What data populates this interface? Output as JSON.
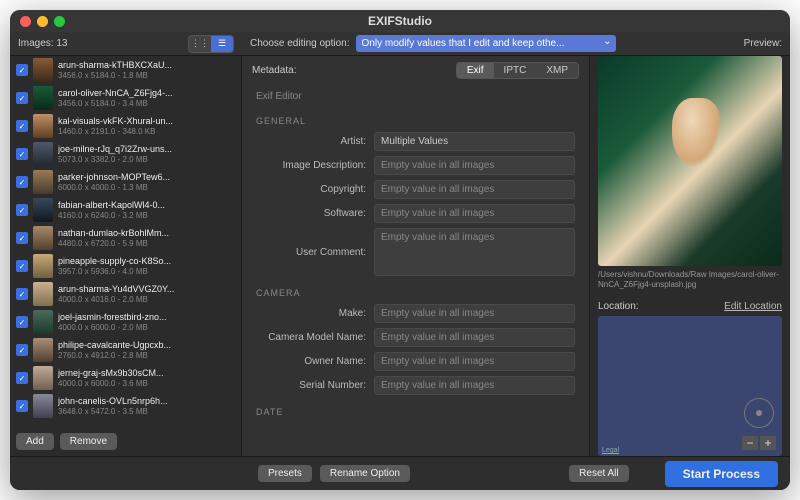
{
  "window": {
    "title": "EXIFStudio"
  },
  "toolbar": {
    "images_label": "Images:",
    "images_count": "13",
    "editing_label": "Choose editing option:",
    "editing_value": "Only modify values that I edit and keep othe...",
    "preview_label": "Preview:"
  },
  "sidebar": {
    "items": [
      {
        "name": "arun-sharma-kTHBXCXaU...",
        "info": "3456.0 x 5184.0 - 1.8 MB"
      },
      {
        "name": "carol-oliver-NnCA_Z6Fjg4-...",
        "info": "3456.0 x 5184.0 - 3.4 MB"
      },
      {
        "name": "kal-visuals-vkFK-Xhural-un...",
        "info": "1460.0 x 2191.0 - 348.0 KB"
      },
      {
        "name": "joe-milne-rJq_q7i2Zrw-uns...",
        "info": "5073.0 x 3382.0 - 2.0 MB"
      },
      {
        "name": "parker-johnson-MOPTew6...",
        "info": "6000.0 x 4000.0 - 1.3 MB"
      },
      {
        "name": "fabian-albert-KapolWl4-0...",
        "info": "4160.0 x 6240.0 - 3.2 MB"
      },
      {
        "name": "nathan-dumlao-krBohlMm...",
        "info": "4480.0 x 6720.0 - 5.9 MB"
      },
      {
        "name": "pineapple-supply-co-K8So...",
        "info": "3957.0 x 5936.0 - 4.0 MB"
      },
      {
        "name": "arun-sharma-Yu4dVVGZ0Y...",
        "info": "4000.0 x 4016.0 - 2.0 MB"
      },
      {
        "name": "joel-jasmin-forestbird-zno...",
        "info": "4000.0 x 6000.0 - 2.0 MB"
      },
      {
        "name": "philipe-cavalcante-Ugpcxb...",
        "info": "2760.0 x 4912.0 - 2.8 MB"
      },
      {
        "name": "jernej-graj-sMx9b30sCM...",
        "info": "4000.0 x 6000.0 - 3.6 MB"
      },
      {
        "name": "john-canelis-OVLn5nrp6h...",
        "info": "3648.0 x 5472.0 - 3.5 MB"
      }
    ],
    "add": "Add",
    "remove": "Remove"
  },
  "metadata": {
    "label": "Metadata:",
    "tabs": {
      "exif": "Exif",
      "iptc": "IPTC",
      "xmp": "XMP"
    },
    "editor_title": "Exif Editor",
    "sections": {
      "general": {
        "title": "GENERAL",
        "artist_l": "Artist:",
        "artist_v": "Multiple Values",
        "desc_l": "Image Description:",
        "desc_v": "Empty value in all images",
        "copy_l": "Copyright:",
        "copy_v": "Empty value in all images",
        "soft_l": "Software:",
        "soft_v": "Empty value in all images",
        "ucom_l": "User Comment:",
        "ucom_v": "Empty value in all images"
      },
      "camera": {
        "title": "CAMERA",
        "make_l": "Make:",
        "make_v": "Empty value in all images",
        "model_l": "Camera Model Name:",
        "model_v": "Empty value in all images",
        "owner_l": "Owner Name:",
        "owner_v": "Empty value in all images",
        "serial_l": "Serial Number:",
        "serial_v": "Empty value in all images"
      },
      "date": {
        "title": "DATE"
      }
    }
  },
  "preview": {
    "path": "/Users/vishnu/Downloads/Raw Images/carol-oliver-NnCA_Z6Fjg4-unsplash.jpg",
    "location_label": "Location:",
    "edit_location": "Edit Location",
    "legal": "Legal"
  },
  "footer": {
    "presets": "Presets",
    "rename": "Rename Option",
    "reset": "Reset All",
    "start": "Start Process"
  }
}
